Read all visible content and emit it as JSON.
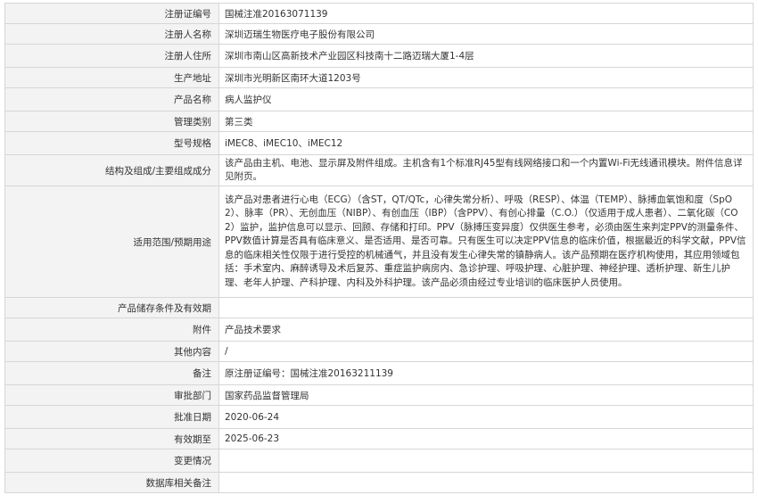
{
  "rows": [
    {
      "label": "注册证编号",
      "value": "国械注准20163071139"
    },
    {
      "label": "注册人名称",
      "value": "深圳迈瑞生物医疗电子股份有限公司"
    },
    {
      "label": "注册人住所",
      "value": "深圳市南山区高新技术产业园区科技南十二路迈瑞大厦1-4层"
    },
    {
      "label": "生产地址",
      "value": "深圳市光明新区南环大道1203号"
    },
    {
      "label": "产品名称",
      "value": "病人监护仪"
    },
    {
      "label": "管理类别",
      "value": "第三类"
    },
    {
      "label": "型号规格",
      "value": "iMEC8、iMEC10、iMEC12"
    },
    {
      "label": "结构及组成/主要组成成分",
      "value": "该产品由主机、电池、显示屏及附件组成。主机含有1个标准RJ45型有线网络接口和一个内置Wi-Fi无线通讯模块。附件信息详见附页。"
    },
    {
      "label": "适用范围/预期用途",
      "value": "该产品对患者进行心电（ECG）（含ST，QT/QTc，心律失常分析）、呼吸（RESP）、体温（TEMP）、脉搏血氧饱和度（SpO2）、脉率（PR）、无创血压（NIBP）、有创血压（IBP）（含PPV）、有创心排量（C.O.）（仅适用于成人患者）、二氧化碳（CO2）监护，监护信息可以显示、回顾、存储和打印。PPV（脉搏压变异度）仅供医生参考，必须由医生来判定PPV的测量条件、PPV数值计算是否具有临床意义、是否适用、是否可靠。只有医生可以决定PPV信息的临床价值，根据最近的科学文献，PPV信息的临床相关性仅限于进行受控的机械通气，并且没有发生心律失常的镇静病人。该产品预期在医疗机构使用，其应用领域包括：手术室内、麻醉诱导及术后复苏、重症监护病房内、急诊护理、呼吸护理、心脏护理、神经护理、透析护理、新生儿护理、老年人护理、产科护理、内科及外科护理。该产品必须由经过专业培训的临床医护人员使用。"
    },
    {
      "label": "产品储存条件及有效期",
      "value": ""
    },
    {
      "label": "附件",
      "value": "产品技术要求"
    },
    {
      "label": "其他内容",
      "value": "/"
    },
    {
      "label": "备注",
      "value": "原注册证编号：国械注准20163211139"
    },
    {
      "label": "审批部门",
      "value": "国家药品监督管理局"
    },
    {
      "label": "批准日期",
      "value": "2020-06-24"
    },
    {
      "label": "有效期至",
      "value": "2025-06-23"
    },
    {
      "label": "变更情况",
      "value": ""
    },
    {
      "label": "数据库相关备注",
      "value": ""
    }
  ]
}
